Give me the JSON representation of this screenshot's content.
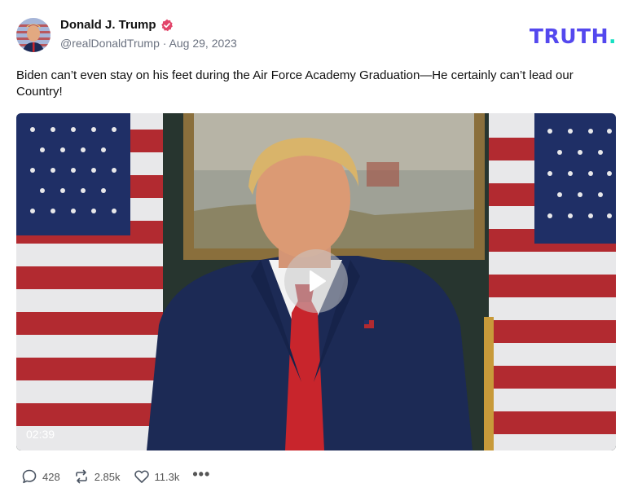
{
  "post": {
    "author_name": "Donald J. Trump",
    "handle": "@realDonaldTrump",
    "separator": "·",
    "date": "Aug 29, 2023",
    "text": "Biden can’t even stay on his feet during the Air Force Academy Graduation—He certainly can’t lead our Country!"
  },
  "brand": {
    "logo_main": "TRUTH",
    "logo_dot": ".",
    "logo_color": "#5448ee",
    "logo_dot_color": "#17e0c2"
  },
  "video": {
    "duration": "02:39"
  },
  "actions": {
    "replies": "428",
    "retruths": "2.85k",
    "likes": "11.3k",
    "more": "•••"
  },
  "icons": {
    "verified": "verified-badge-icon",
    "reply": "comment-bubble-icon",
    "retruth": "repost-arrows-icon",
    "like": "heart-icon",
    "more": "more-dots-icon",
    "play": "play-icon"
  }
}
